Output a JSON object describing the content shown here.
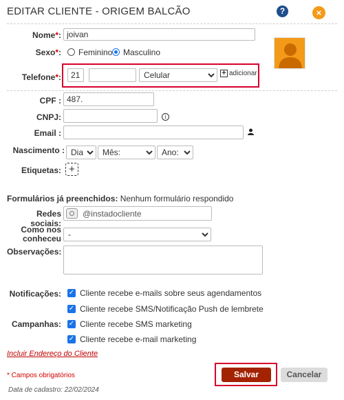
{
  "dialog": {
    "title": "EDITAR CLIENTE - ORIGEM BALCÃO",
    "help_icon": "?",
    "close_icon": "×"
  },
  "form": {
    "nome": {
      "label": "Nome",
      "required_mark": "*",
      "colon": ":",
      "value": "joivan"
    },
    "sexo": {
      "label": "Sexo",
      "required_mark": "*",
      "colon": ":",
      "options": [
        "Feminino",
        "Masculino"
      ],
      "selected": "Masculino"
    },
    "telefone": {
      "label": "Telefone",
      "required_mark": "*",
      "colon": ":",
      "ddd": "21",
      "number": "",
      "type": "Celular",
      "add_label": "adicionar"
    },
    "cpf": {
      "label": "CPF :",
      "value": "487."
    },
    "cnpj": {
      "label": "CNPJ:",
      "value": ""
    },
    "email": {
      "label": "Email :",
      "value": ""
    },
    "nascimento": {
      "label": "Nascimento :",
      "dia": "Dia:",
      "mes": "Mês:",
      "ano": "Ano:"
    },
    "etiquetas": {
      "label": "Etiquetas:"
    },
    "formularios": {
      "label": "Formulários já preenchidos:",
      "value": "Nenhum formulário respondido"
    },
    "redes_sociais": {
      "label": "Redes sociais:",
      "placeholder": "@instadocliente"
    },
    "como_nos_conheceu": {
      "label_line1": "Como nos",
      "label_line2": "conheceu",
      "value": "-"
    },
    "observacoes": {
      "label": "Observações:",
      "value": ""
    },
    "notificacoes": {
      "label": "Notificações:",
      "items": [
        "Cliente recebe e-mails sobre seus agendamentos",
        "Cliente recebe SMS/Notificação Push de lembrete"
      ]
    },
    "campanhas": {
      "label": "Campanhas:",
      "items": [
        "Cliente recebe SMS marketing",
        "Cliente recebe e-mail marketing"
      ]
    },
    "incluir_endereco": "Incluir Endereço do Cliente",
    "campos_obrigatorios": "* Campos obrigatórios",
    "data_cadastro": "Data de cadastro: 22/02/2024"
  },
  "buttons": {
    "save": "Salvar",
    "cancel": "Cancelar"
  },
  "colors": {
    "accent": "#1a73e8",
    "save": "#a32200",
    "highlight": "#d6002a",
    "close": "#f39a18"
  }
}
